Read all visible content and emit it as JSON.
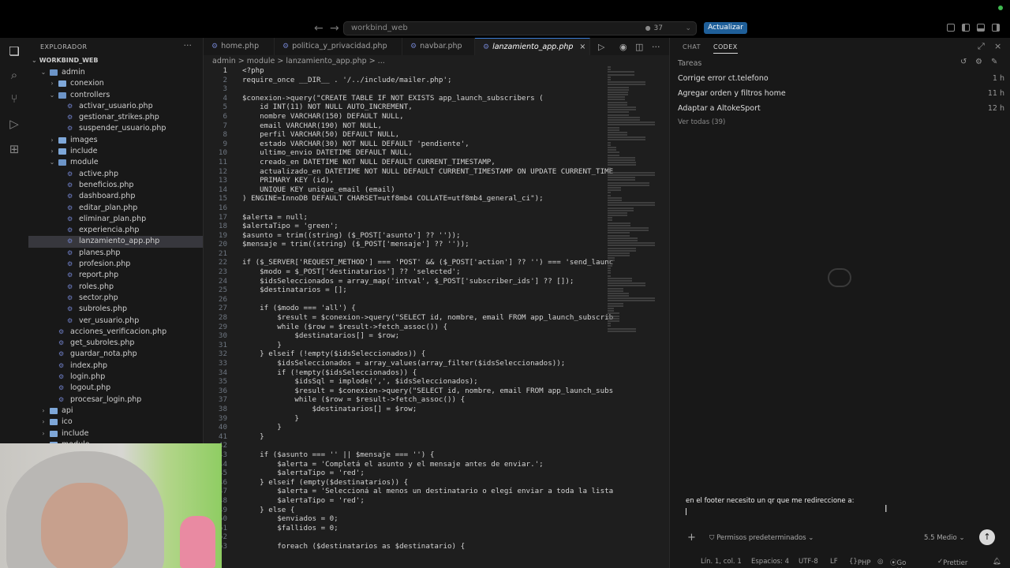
{
  "titlebar": {
    "search_text": "workbind_web",
    "change_count": "37",
    "update_label": "Actualizar"
  },
  "sidebar": {
    "header": "EXPLORADOR",
    "root": "WORKBIND_WEB",
    "tree": [
      {
        "label": "admin",
        "kind": "folder",
        "depth": 1,
        "open": true
      },
      {
        "label": "conexion",
        "kind": "folder",
        "depth": 2,
        "open": false
      },
      {
        "label": "controllers",
        "kind": "folder",
        "depth": 2,
        "open": true
      },
      {
        "label": "activar_usuario.php",
        "kind": "php",
        "depth": 3
      },
      {
        "label": "gestionar_strikes.php",
        "kind": "php",
        "depth": 3
      },
      {
        "label": "suspender_usuario.php",
        "kind": "php",
        "depth": 3
      },
      {
        "label": "images",
        "kind": "folder",
        "depth": 2,
        "open": false
      },
      {
        "label": "include",
        "kind": "folder",
        "depth": 2,
        "open": false
      },
      {
        "label": "module",
        "kind": "folder",
        "depth": 2,
        "open": true
      },
      {
        "label": "active.php",
        "kind": "php",
        "depth": 3
      },
      {
        "label": "beneficios.php",
        "kind": "php",
        "depth": 3
      },
      {
        "label": "dashboard.php",
        "kind": "php",
        "depth": 3
      },
      {
        "label": "editar_plan.php",
        "kind": "php",
        "depth": 3
      },
      {
        "label": "eliminar_plan.php",
        "kind": "php",
        "depth": 3
      },
      {
        "label": "experiencia.php",
        "kind": "php",
        "depth": 3
      },
      {
        "label": "lanzamiento_app.php",
        "kind": "php",
        "depth": 3,
        "selected": true
      },
      {
        "label": "planes.php",
        "kind": "php",
        "depth": 3
      },
      {
        "label": "profesion.php",
        "kind": "php",
        "depth": 3
      },
      {
        "label": "report.php",
        "kind": "php",
        "depth": 3
      },
      {
        "label": "roles.php",
        "kind": "php",
        "depth": 3
      },
      {
        "label": "sector.php",
        "kind": "php",
        "depth": 3
      },
      {
        "label": "subroles.php",
        "kind": "php",
        "depth": 3
      },
      {
        "label": "ver_usuario.php",
        "kind": "php",
        "depth": 3
      },
      {
        "label": "acciones_verificacion.php",
        "kind": "php",
        "depth": 2
      },
      {
        "label": "get_subroles.php",
        "kind": "php",
        "depth": 2
      },
      {
        "label": "guardar_nota.php",
        "kind": "php",
        "depth": 2
      },
      {
        "label": "index.php",
        "kind": "php",
        "depth": 2
      },
      {
        "label": "login.php",
        "kind": "php",
        "depth": 2
      },
      {
        "label": "logout.php",
        "kind": "php",
        "depth": 2
      },
      {
        "label": "procesar_login.php",
        "kind": "php",
        "depth": 2
      },
      {
        "label": "api",
        "kind": "folder",
        "depth": 1,
        "open": false
      },
      {
        "label": "ico",
        "kind": "folder",
        "depth": 1,
        "open": false
      },
      {
        "label": "include",
        "kind": "folder",
        "depth": 1,
        "open": false
      },
      {
        "label": "module",
        "kind": "folder",
        "depth": 1,
        "open": false
      }
    ]
  },
  "editor": {
    "tabs": [
      {
        "label": "home.php",
        "active": false
      },
      {
        "label": "politica_y_privacidad.php",
        "active": false
      },
      {
        "label": "navbar.php",
        "active": false
      },
      {
        "label": "lanzamiento_app.php",
        "active": true
      }
    ],
    "breadcrumb": "admin > module > lanzamiento_app.php > ...",
    "lines": [
      {
        "n": "1",
        "t": "<?php"
      },
      {
        "n": "2",
        "t": "require_once __DIR__ . '/../include/mailer.php';"
      },
      {
        "n": "3",
        "t": ""
      },
      {
        "n": "4",
        "t": "$conexion->query(\"CREATE TABLE IF NOT EXISTS app_launch_subscribers ("
      },
      {
        "n": "5",
        "t": "    id INT(11) NOT NULL AUTO_INCREMENT,"
      },
      {
        "n": "6",
        "t": "    nombre VARCHAR(150) DEFAULT NULL,"
      },
      {
        "n": "7",
        "t": "    email VARCHAR(190) NOT NULL,"
      },
      {
        "n": "8",
        "t": "    perfil VARCHAR(50) DEFAULT NULL,"
      },
      {
        "n": "9",
        "t": "    estado VARCHAR(30) NOT NULL DEFAULT 'pendiente',"
      },
      {
        "n": "10",
        "t": "    ultimo_envio DATETIME DEFAULT NULL,"
      },
      {
        "n": "11",
        "t": "    creado_en DATETIME NOT NULL DEFAULT CURRENT_TIMESTAMP,"
      },
      {
        "n": "12",
        "t": "    actualizado_en DATETIME NOT NULL DEFAULT CURRENT_TIMESTAMP ON UPDATE CURRENT_TIME"
      },
      {
        "n": "13",
        "t": "    PRIMARY KEY (id),"
      },
      {
        "n": "14",
        "t": "    UNIQUE KEY unique_email (email)"
      },
      {
        "n": "15",
        "t": ") ENGINE=InnoDB DEFAULT CHARSET=utf8mb4 COLLATE=utf8mb4_general_ci\");"
      },
      {
        "n": "16",
        "t": ""
      },
      {
        "n": "17",
        "t": "$alerta = null;"
      },
      {
        "n": "18",
        "t": "$alertaTipo = 'green';"
      },
      {
        "n": "19",
        "t": "$asunto = trim((string) ($_POST['asunto'] ?? ''));"
      },
      {
        "n": "20",
        "t": "$mensaje = trim((string) ($_POST['mensaje'] ?? ''));"
      },
      {
        "n": "21",
        "t": ""
      },
      {
        "n": "22",
        "t": "if ($_SERVER['REQUEST_METHOD'] === 'POST' && ($_POST['action'] ?? '') === 'send_launc"
      },
      {
        "n": "23",
        "t": "    $modo = $_POST['destinatarios'] ?? 'selected';"
      },
      {
        "n": "24",
        "t": "    $idsSeleccionados = array_map('intval', $_POST['subscriber_ids'] ?? []);"
      },
      {
        "n": "25",
        "t": "    $destinatarios = [];"
      },
      {
        "n": "26",
        "t": ""
      },
      {
        "n": "27",
        "t": "    if ($modo === 'all') {"
      },
      {
        "n": "28",
        "t": "        $result = $conexion->query(\"SELECT id, nombre, email FROM app_launch_subscrib"
      },
      {
        "n": "29",
        "t": "        while ($row = $result->fetch_assoc()) {"
      },
      {
        "n": "30",
        "t": "            $destinatarios[] = $row;"
      },
      {
        "n": "31",
        "t": "        }"
      },
      {
        "n": "32",
        "t": "    } elseif (!empty($idsSeleccionados)) {"
      },
      {
        "n": "33",
        "t": "        $idsSeleccionados = array_values(array_filter($idsSeleccionados));"
      },
      {
        "n": "34",
        "t": "        if (!empty($idsSeleccionados)) {"
      },
      {
        "n": "35",
        "t": "            $idsSql = implode(',', $idsSeleccionados);"
      },
      {
        "n": "36",
        "t": "            $result = $conexion->query(\"SELECT id, nombre, email FROM app_launch_subs"
      },
      {
        "n": "37",
        "t": "            while ($row = $result->fetch_assoc()) {"
      },
      {
        "n": "38",
        "t": "                $destinatarios[] = $row;"
      },
      {
        "n": "39",
        "t": "            }"
      },
      {
        "n": "40",
        "t": "        }"
      },
      {
        "n": "41",
        "t": "    }"
      },
      {
        "n": "42",
        "t": ""
      },
      {
        "n": "43",
        "t": "    if ($asunto === '' || $mensaje === '') {"
      },
      {
        "n": "44",
        "t": "        $alerta = 'Completá el asunto y el mensaje antes de enviar.';"
      },
      {
        "n": "45",
        "t": "        $alertaTipo = 'red';"
      },
      {
        "n": "46",
        "t": "    } elseif (empty($destinatarios)) {"
      },
      {
        "n": "47",
        "t": "        $alerta = 'Seleccioná al menos un destinatario o elegí enviar a toda la lista"
      },
      {
        "n": "48",
        "t": "        $alertaTipo = 'red';"
      },
      {
        "n": "49",
        "t": "    } else {"
      },
      {
        "n": "50",
        "t": "        $enviados = 0;"
      },
      {
        "n": "51",
        "t": "        $fallidos = 0;"
      },
      {
        "n": "52",
        "t": ""
      },
      {
        "n": "53",
        "t": "        foreach ($destinatarios as $destinatario) {"
      }
    ]
  },
  "panel": {
    "tab_chat": "CHAT",
    "tab_codex": "CODEX",
    "tareas": "Tareas",
    "tasks": [
      {
        "title": "Corrige error ct.telefono",
        "time": "1 h"
      },
      {
        "title": "Agregar orden y filtros home",
        "time": "11 h"
      },
      {
        "title": "Adaptar a AltokeSport",
        "time": "12 h"
      }
    ],
    "ver_todas": "Ver todas (39)",
    "prompt": "en el footer necesito un qr que me redireccione a:",
    "permissions": "Permisos predeterminados",
    "model": "5.5  Medio"
  },
  "statusbar": {
    "position": "Lín. 1, col. 1",
    "spaces": "Espacios: 4",
    "encoding": "UTF-8",
    "eol": "LF",
    "language": "PHP",
    "golive": "Go Live",
    "prettier": "Prettier"
  }
}
